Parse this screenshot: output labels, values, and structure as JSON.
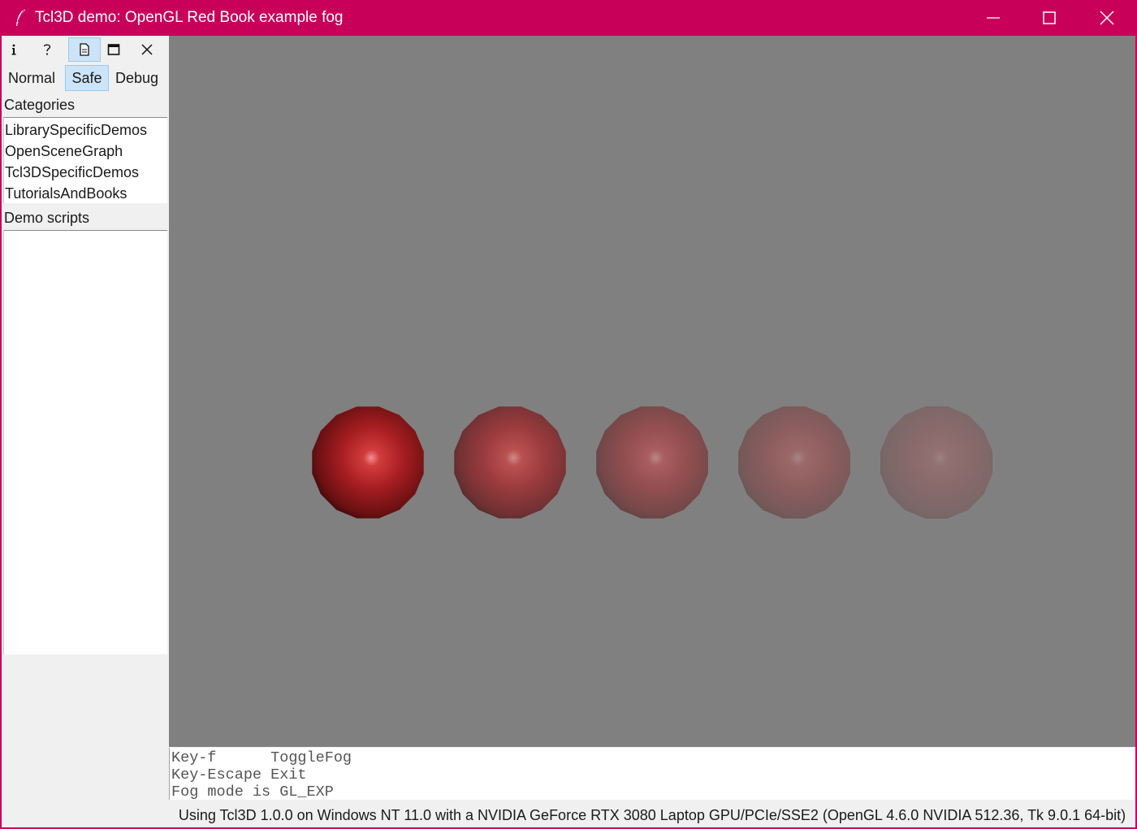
{
  "window": {
    "title": "Tcl3D demo: OpenGL Red Book example fog",
    "accent": "#c8005a"
  },
  "toolbar": {
    "icons": [
      "info-icon",
      "help-icon",
      "document-icon",
      "maximize-icon",
      "close-icon"
    ],
    "selected": "document-icon"
  },
  "modes": {
    "items": [
      "Normal",
      "Safe",
      "Debug"
    ],
    "selected": "Safe"
  },
  "categories": {
    "label": "Categories",
    "items": [
      "LibrarySpecificDemos",
      "OpenSceneGraph",
      "Tcl3DSpecificDemos",
      "TutorialsAndBooks"
    ]
  },
  "demo_scripts": {
    "label": "Demo scripts",
    "items": []
  },
  "scene": {
    "background": "#808080",
    "sphere_color": "#b01e23",
    "fog_color": "#808080",
    "fog_amounts": [
      0.0,
      0.3,
      0.5,
      0.66,
      0.78
    ]
  },
  "console": {
    "lines": [
      "Key-f      ToggleFog",
      "Key-Escape Exit",
      "Fog mode is GL_EXP"
    ]
  },
  "status": {
    "text": "Using Tcl3D 1.0.0 on Windows NT 11.0 with a NVIDIA GeForce RTX 3080 Laptop GPU/PCIe/SSE2 (OpenGL 4.6.0 NVIDIA 512.36, Tk 9.0.1 64-bit)"
  }
}
